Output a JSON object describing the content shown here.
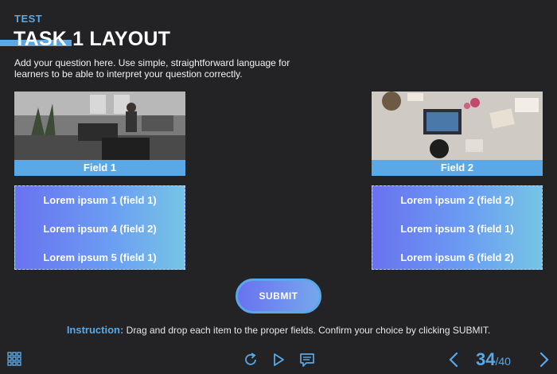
{
  "header": {
    "tag": "TEST",
    "title": "TASK 1 LAYOUT",
    "question": "Add your question here. Use simple, straightforward language for learners to be able to interpret your question correctly."
  },
  "fields": [
    {
      "label": "Field 1",
      "photo": "office-workspace-photo",
      "items": [
        "Lorem ipsum 1 (field 1)",
        "Lorem ipsum 4 (field 2)",
        "Lorem ipsum 5 (field 1)"
      ]
    },
    {
      "label": "Field 2",
      "photo": "desk-laptop-photo",
      "items": [
        "Lorem ipsum 2 (field 2)",
        "Lorem ipsum 3 (field 1)",
        "Lorem ipsum 6 (field 2)"
      ]
    }
  ],
  "submit_label": "SUBMIT",
  "instruction": {
    "lead": "Instruction:",
    "text": " Drag and drop each item to the proper fields. Confirm your choice by clicking SUBMIT."
  },
  "footer": {
    "icons": [
      "grid-menu-icon",
      "replay-icon",
      "play-icon",
      "comment-icon",
      "chevron-left-icon",
      "chevron-right-icon"
    ],
    "page_current": "34",
    "page_total": "/40"
  },
  "colors": {
    "background": "#232325",
    "accent": "#5aa8e6",
    "gradient_start": "#6a72f0",
    "gradient_end": "#76c4e6"
  }
}
